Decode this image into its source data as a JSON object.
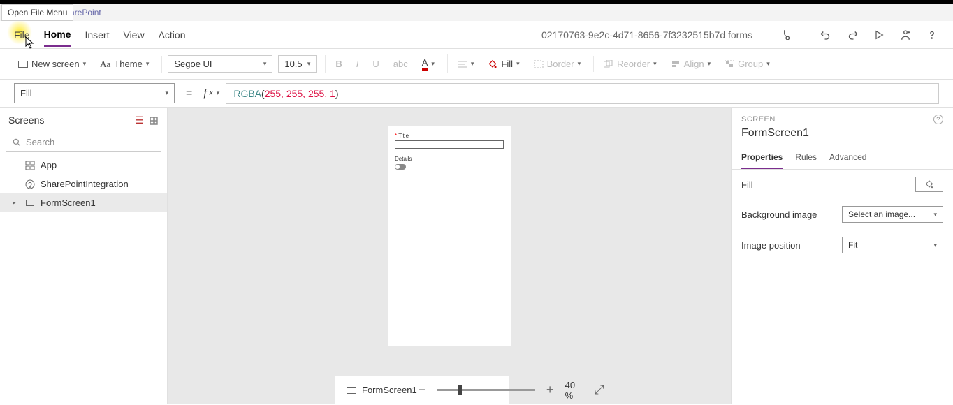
{
  "tooltip": "Open File Menu",
  "brand": "arePoint",
  "menu": {
    "file": "File",
    "home": "Home",
    "insert": "Insert",
    "view": "View",
    "action": "Action"
  },
  "docTitle": "02170763-9e2c-4d71-8656-7f3232515b7d forms",
  "ribbon": {
    "newScreen": "New screen",
    "theme": "Theme",
    "font": "Segoe UI",
    "fontSize": "10.5",
    "fill": "Fill",
    "border": "Border",
    "reorder": "Reorder",
    "align": "Align",
    "group": "Group"
  },
  "formula": {
    "property": "Fill",
    "fn": "RGBA",
    "args": "255, 255, 255, 1"
  },
  "tree": {
    "title": "Screens",
    "searchPlaceholder": "Search",
    "items": {
      "app": "App",
      "integration": "SharePointIntegration",
      "screen": "FormScreen1"
    }
  },
  "canvas": {
    "titleLabel": "Title",
    "detailsLabel": "Details"
  },
  "props": {
    "category": "SCREEN",
    "name": "FormScreen1",
    "tabs": {
      "properties": "Properties",
      "rules": "Rules",
      "advanced": "Advanced"
    },
    "fillLabel": "Fill",
    "bgLabel": "Background image",
    "bgValue": "Select an image...",
    "posLabel": "Image position",
    "posValue": "Fit"
  },
  "status": {
    "screen": "FormScreen1",
    "zoom": "40  %"
  }
}
